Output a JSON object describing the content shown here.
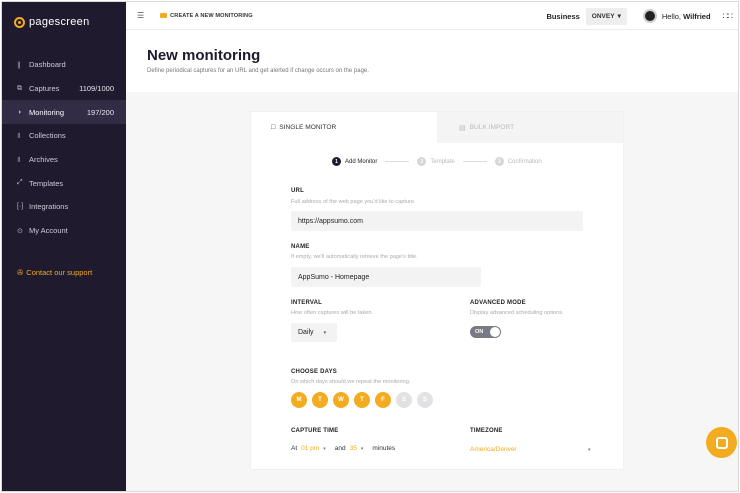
{
  "brand": {
    "name": "pagescreen",
    "accent": "#f3ac1f"
  },
  "sidebar": {
    "items": [
      {
        "icon": "bar-chart-icon",
        "glyph": "∥",
        "label": "Dashboard",
        "count": ""
      },
      {
        "icon": "captures-icon",
        "glyph": "⧉",
        "label": "Captures",
        "count": "1109/1000"
      },
      {
        "icon": "monitoring-icon",
        "glyph": "◑",
        "label": "Monitoring",
        "count": "197/200"
      },
      {
        "icon": "collections-icon",
        "glyph": "⫫",
        "label": "Collections",
        "count": ""
      },
      {
        "icon": "archives-icon",
        "glyph": "⫫",
        "label": "Archives",
        "count": ""
      },
      {
        "icon": "templates-icon",
        "glyph": "⤢",
        "label": "Templates",
        "count": ""
      },
      {
        "icon": "integrations-icon",
        "glyph": "[·]",
        "label": "Integrations",
        "count": ""
      },
      {
        "icon": "user-icon",
        "glyph": "⊙",
        "label": "My Account",
        "count": ""
      }
    ],
    "support": {
      "label": "Contact our support",
      "glyph": "✇"
    }
  },
  "topbar": {
    "menu_glyph": "☰",
    "breadcrumb": "CREATE A NEW MONITORING",
    "business_label": "Business",
    "business_value": "ONVEY",
    "greeting": "Hello,",
    "user_name": "Wilfried",
    "apps_glyph": "∷∷"
  },
  "header": {
    "title": "New monitoring",
    "subtitle": "Define periodical captures for an URL and get alerted if change occurs on the page."
  },
  "tabs": [
    {
      "label": "SINGLE MONITOR",
      "glyph": "□"
    },
    {
      "label": "BULK IMPORT",
      "glyph": "▤"
    }
  ],
  "steps": [
    {
      "num": "1",
      "label": "Add Monitor"
    },
    {
      "num": "2",
      "label": "Template"
    },
    {
      "num": "3",
      "label": "Confirmation"
    }
  ],
  "form": {
    "url": {
      "label": "URL",
      "help": "Full address of the web page you'd like to capture.",
      "value": "https://appsumo.com"
    },
    "name": {
      "label": "NAME",
      "help": "If empty, we'll automatically retrieve the page's title.",
      "value": "AppSumo - Homepage"
    },
    "interval": {
      "label": "INTERVAL",
      "help": "How often captures will be taken.",
      "value": "Daily"
    },
    "advanced": {
      "label": "ADVANCED MODE",
      "help": "Display advanced scheduling options.",
      "toggle": "ON"
    },
    "days": {
      "label": "CHOOSE DAYS",
      "help": "On which days should we repeat the monitoring.",
      "items": [
        {
          "letter": "M",
          "on": true
        },
        {
          "letter": "T",
          "on": true
        },
        {
          "letter": "W",
          "on": true
        },
        {
          "letter": "T",
          "on": true
        },
        {
          "letter": "F",
          "on": true
        },
        {
          "letter": "S",
          "on": false
        },
        {
          "letter": "S",
          "on": false
        }
      ]
    },
    "capture_time": {
      "label": "CAPTURE TIME",
      "at": "At",
      "hour": "01 pm",
      "and": "and",
      "minutes_value": "35",
      "minutes": "minutes"
    },
    "timezone": {
      "label": "TIMEZONE",
      "value": "America/Denver"
    }
  },
  "caret": "▾"
}
